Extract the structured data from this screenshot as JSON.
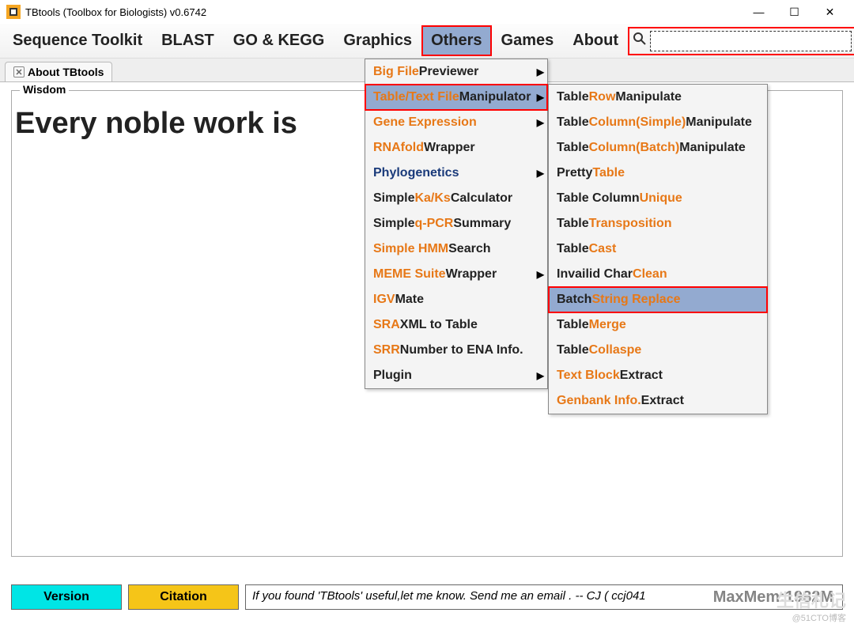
{
  "title": "TBtools (Toolbox for Biologists) v0.6742",
  "menubar": [
    "Sequence Toolkit",
    "BLAST",
    "GO & KEGG",
    "Graphics",
    "Others",
    "Games",
    "About"
  ],
  "active_menu_index": 4,
  "tab": {
    "label": "About TBtools"
  },
  "wisdom": {
    "legend": "Wisdom",
    "text": "Every noble work is"
  },
  "search": {
    "placeholder": ""
  },
  "submenu1": [
    {
      "parts": [
        {
          "t": "Big File",
          "c": "orange"
        },
        {
          "t": " Previewer",
          "c": "black"
        }
      ],
      "arrow": true
    },
    {
      "parts": [
        {
          "t": "Table/Text File",
          "c": "orange"
        },
        {
          "t": " Manipulator",
          "c": "black"
        }
      ],
      "arrow": true,
      "highlight": true,
      "redbox": true
    },
    {
      "parts": [
        {
          "t": "Gene Expression",
          "c": "orange"
        }
      ],
      "arrow": true
    },
    {
      "parts": [
        {
          "t": "RNAfold",
          "c": "orange"
        },
        {
          "t": " Wrapper",
          "c": "black"
        }
      ]
    },
    {
      "parts": [
        {
          "t": "Phylogenetics",
          "c": "navy"
        }
      ],
      "arrow": true
    },
    {
      "parts": [
        {
          "t": "Simple ",
          "c": "black"
        },
        {
          "t": "Ka/Ks",
          "c": "orange"
        },
        {
          "t": " Calculator",
          "c": "black"
        }
      ]
    },
    {
      "parts": [
        {
          "t": "Simple ",
          "c": "black"
        },
        {
          "t": "q-PCR",
          "c": "orange"
        },
        {
          "t": " Summary",
          "c": "black"
        }
      ]
    },
    {
      "parts": [
        {
          "t": "Simple HMM",
          "c": "orange"
        },
        {
          "t": " Search",
          "c": "black"
        }
      ]
    },
    {
      "parts": [
        {
          "t": "MEME Suite",
          "c": "orange"
        },
        {
          "t": " Wrapper",
          "c": "black"
        }
      ],
      "arrow": true
    },
    {
      "parts": [
        {
          "t": "IGV",
          "c": "orange"
        },
        {
          "t": " Mate",
          "c": "black"
        }
      ]
    },
    {
      "parts": [
        {
          "t": "SRA",
          "c": "orange"
        },
        {
          "t": " XML to Table",
          "c": "black"
        }
      ]
    },
    {
      "parts": [
        {
          "t": "SRR",
          "c": "orange"
        },
        {
          "t": " Number to ENA Info.",
          "c": "black"
        }
      ]
    },
    {
      "parts": [
        {
          "t": "Plugin",
          "c": "black"
        }
      ],
      "arrow": true
    }
  ],
  "submenu2": [
    {
      "parts": [
        {
          "t": "Table ",
          "c": "black"
        },
        {
          "t": "Row",
          "c": "orange"
        },
        {
          "t": " Manipulate",
          "c": "black"
        }
      ]
    },
    {
      "parts": [
        {
          "t": "Table ",
          "c": "black"
        },
        {
          "t": "Column(Simple)",
          "c": "orange"
        },
        {
          "t": " Manipulate",
          "c": "black"
        }
      ]
    },
    {
      "parts": [
        {
          "t": "Table ",
          "c": "black"
        },
        {
          "t": "Column(Batch)",
          "c": "orange"
        },
        {
          "t": " Manipulate",
          "c": "black"
        }
      ]
    },
    {
      "parts": [
        {
          "t": "Pretty ",
          "c": "black"
        },
        {
          "t": "Table",
          "c": "orange"
        }
      ]
    },
    {
      "parts": [
        {
          "t": "Table Column ",
          "c": "black"
        },
        {
          "t": "Unique",
          "c": "orange"
        }
      ]
    },
    {
      "parts": [
        {
          "t": "Table ",
          "c": "black"
        },
        {
          "t": "Transposition",
          "c": "orange"
        }
      ]
    },
    {
      "parts": [
        {
          "t": "Table ",
          "c": "black"
        },
        {
          "t": "Cast",
          "c": "orange"
        }
      ]
    },
    {
      "parts": [
        {
          "t": "Invailid Char ",
          "c": "black"
        },
        {
          "t": "Clean",
          "c": "orange"
        }
      ]
    },
    {
      "parts": [
        {
          "t": "Batch ",
          "c": "black"
        },
        {
          "t": "String Replace",
          "c": "orange"
        }
      ],
      "highlight": true,
      "redbox": true
    },
    {
      "parts": [
        {
          "t": "Table ",
          "c": "black"
        },
        {
          "t": "Merge",
          "c": "orange"
        }
      ]
    },
    {
      "parts": [
        {
          "t": "Table ",
          "c": "black"
        },
        {
          "t": "Collaspe",
          "c": "orange"
        }
      ]
    },
    {
      "parts": [
        {
          "t": "Text Block",
          "c": "orange"
        },
        {
          "t": " Extract",
          "c": "black"
        }
      ]
    },
    {
      "parts": [
        {
          "t": "Genbank Info.",
          "c": "orange"
        },
        {
          "t": " Extract",
          "c": "black"
        }
      ]
    }
  ],
  "bottom": {
    "version": "Version",
    "citation": "Citation",
    "message": "If you found 'TBtools' useful,let me know. Send me an email . -- CJ   ( ccj041",
    "maxmem": "MaxMem:1982M"
  },
  "watermark": {
    "blog": "@51CTO博客",
    "logo": "生信札记"
  }
}
